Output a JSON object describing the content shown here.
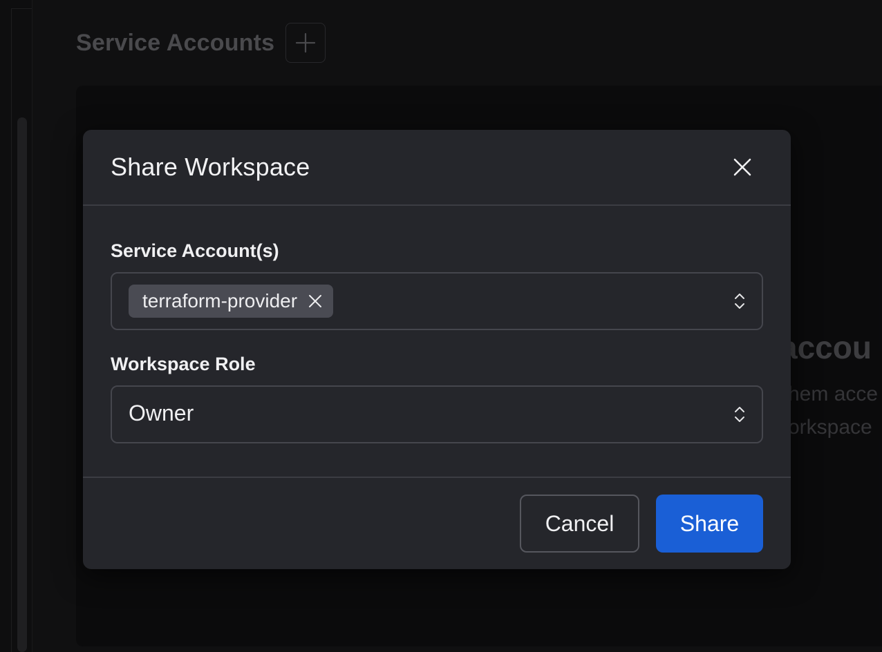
{
  "background": {
    "page_title": "Service Accounts",
    "add_icon": "plus-icon",
    "empty_state": {
      "title_fragment": "accou",
      "line1_fragment": "hem acce",
      "line2_fragment": "orkspace"
    }
  },
  "modal": {
    "title": "Share Workspace",
    "close_icon": "close-icon",
    "service_accounts": {
      "label": "Service Account(s)",
      "selected": [
        {
          "label": "terraform-provider"
        }
      ]
    },
    "workspace_role": {
      "label": "Workspace Role",
      "value": "Owner"
    },
    "cancel_label": "Cancel",
    "share_label": "Share"
  },
  "colors": {
    "primary": "#1a5fd6",
    "modal_bg": "#25262b",
    "chip_bg": "#4a4b53"
  }
}
